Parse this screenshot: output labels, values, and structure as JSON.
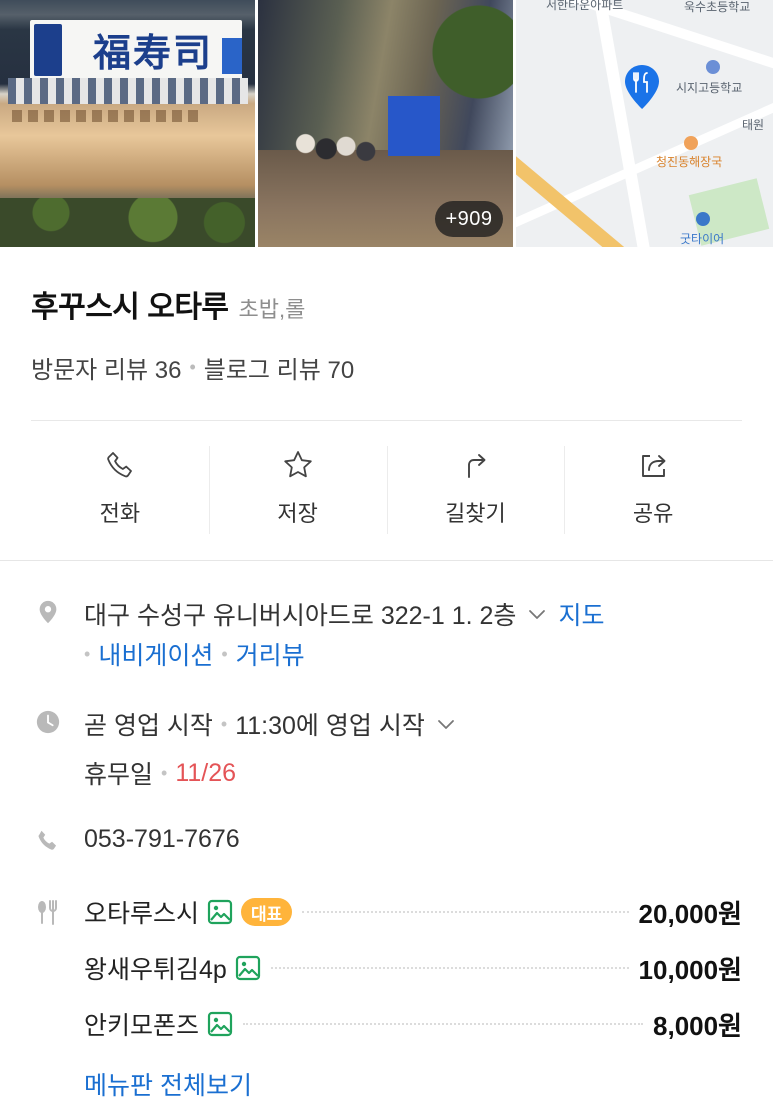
{
  "photos": {
    "storefront_sign": "福寿司",
    "more_count": "+909"
  },
  "map": {
    "labels": [
      "서한타운아파트",
      "욱수초등학교",
      "시지고등학교",
      "태원",
      "청진동해장국",
      "굿타이어"
    ]
  },
  "place": {
    "name": "후꾸스시 오타루",
    "category": "초밥,롤",
    "visitor_review": "방문자 리뷰 36",
    "blog_review": "블로그 리뷰 70"
  },
  "actions": [
    {
      "label": "전화",
      "icon": "phone-icon"
    },
    {
      "label": "저장",
      "icon": "star-icon"
    },
    {
      "label": "길찾기",
      "icon": "directions-icon"
    },
    {
      "label": "공유",
      "icon": "share-icon"
    }
  ],
  "address": {
    "text": "대구 수성구 유니버시아드로 322-1 1. 2층",
    "map_link": "지도",
    "navigation_link": "내비게이션",
    "street_view_link": "거리뷰"
  },
  "hours": {
    "status": "곧 영업 시작",
    "detail": "11:30에 영업 시작",
    "holiday_label": "휴무일",
    "holiday_date": "11/26"
  },
  "phone": "053-791-7676",
  "menu": {
    "items": [
      {
        "name": "오타루스시",
        "badge": "대표",
        "price": "20,000원"
      },
      {
        "name": "왕새우튀김4p",
        "badge": "",
        "price": "10,000원"
      },
      {
        "name": "안키모폰즈",
        "badge": "",
        "price": "8,000원"
      }
    ],
    "more_link": "메뉴판 전체보기"
  },
  "colors": {
    "link": "#1a6fd1",
    "holiday": "#e45457",
    "badge": "#ffb43b",
    "image_icon": "#1fa35c",
    "map_pin": "#1a73e8"
  }
}
